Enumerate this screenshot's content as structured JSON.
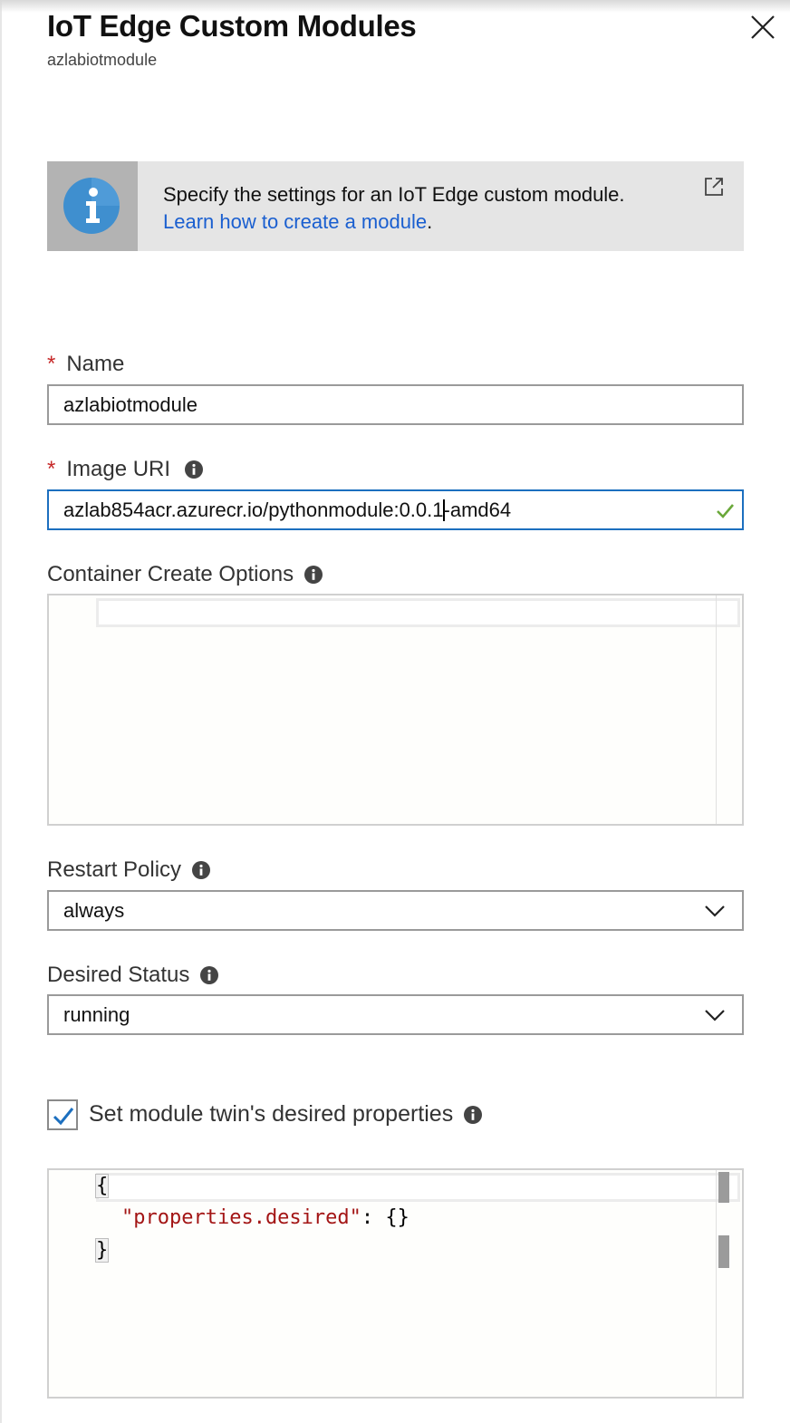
{
  "panel": {
    "title": "IoT Edge Custom Modules",
    "subtitle": "azlabiotmodule"
  },
  "info": {
    "text": "Specify the settings for an IoT Edge custom module.",
    "link": "Learn how to create a module",
    "link_suffix": "."
  },
  "fields": {
    "name": {
      "label": "Name",
      "required_marker": "*",
      "value": "azlabiotmodule"
    },
    "image_uri": {
      "label": "Image URI",
      "required_marker": "*",
      "value_before_cursor": "azlab854acr.azurecr.io/pythonmodule:0.0.1",
      "value_after_cursor": "-amd64"
    },
    "container_create_options": {
      "label": "Container Create Options"
    },
    "restart_policy": {
      "label": "Restart Policy",
      "value": "always"
    },
    "desired_status": {
      "label": "Desired Status",
      "value": "running"
    },
    "twin": {
      "label": "Set module twin's desired properties",
      "checked": true,
      "code_open": "{",
      "code_key": "\"properties.desired\"",
      "code_rest": ": {}",
      "code_close": "}"
    }
  },
  "colors": {
    "accent": "#1c6fbf",
    "required": "#c62828",
    "link": "#1a5fd0",
    "valid": "#6aa83a"
  }
}
